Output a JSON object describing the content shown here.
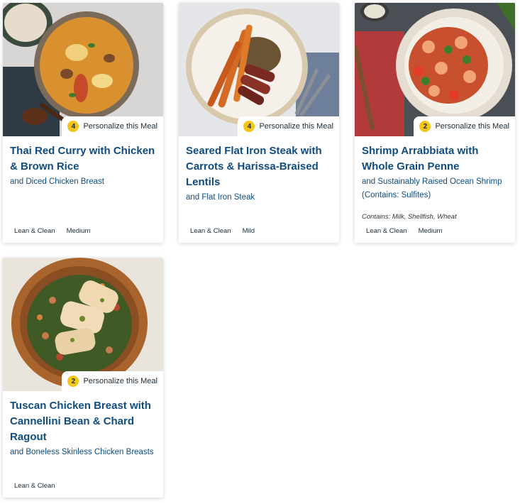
{
  "personalize_label": "Personalize this Meal",
  "meals": [
    {
      "title": "Thai Red Curry with Chicken & Brown Rice",
      "subtitle": "and Diced Chicken Breast",
      "personalize_count": "4",
      "allergens": "",
      "tags": [
        "Lean & Clean",
        "Medium"
      ],
      "photo": "thai-red-curry-photo"
    },
    {
      "title": "Seared Flat Iron Steak with Carrots & Harissa-Braised Lentils",
      "subtitle": "and Flat Iron Steak",
      "personalize_count": "4",
      "allergens": "",
      "tags": [
        "Lean & Clean",
        "Mild"
      ],
      "photo": "flat-iron-steak-photo"
    },
    {
      "title": "Shrimp Arrabbiata with Whole Grain Penne",
      "subtitle": "and Sustainably Raised Ocean Shrimp (Contains: Sulfites)",
      "personalize_count": "2",
      "allergens": "Contains: Milk, Shellfish, Wheat",
      "tags": [
        "Lean & Clean",
        "Medium"
      ],
      "photo": "shrimp-arrabbiata-photo"
    },
    {
      "title": "Tuscan Chicken Breast with Cannellini Bean & Chard Ragout",
      "subtitle": "and Boneless Skinless Chicken Breasts",
      "personalize_count": "2",
      "allergens": "",
      "tags": [
        "Lean & Clean"
      ],
      "photo": "tuscan-chicken-photo"
    }
  ],
  "colors": {
    "title": "#0f4c81",
    "badge": "#f5c518"
  }
}
